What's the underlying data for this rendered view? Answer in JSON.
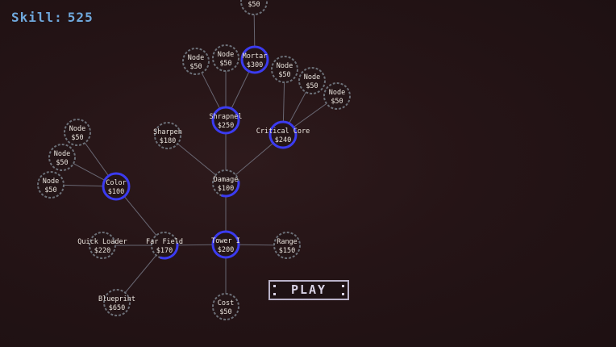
{
  "hud": {
    "skill_label": "Skill:",
    "skill_value": "525"
  },
  "play_label": "PLAY",
  "colors": {
    "accent": "#3b3bf0",
    "edge": "#7d8290",
    "ring_dim": "#6b6f77",
    "hud": "#6fa8dc"
  },
  "nodes": [
    {
      "id": "top",
      "name": "",
      "cost": "$50",
      "state": "dim"
    },
    {
      "id": "node-a",
      "name": "Node",
      "cost": "$50",
      "state": "dim"
    },
    {
      "id": "node-b",
      "name": "Node",
      "cost": "$50",
      "state": "dim"
    },
    {
      "id": "mortar",
      "name": "Mortar",
      "cost": "$300",
      "state": "full"
    },
    {
      "id": "node-c",
      "name": "Node",
      "cost": "$50",
      "state": "dim"
    },
    {
      "id": "node-d",
      "name": "Node",
      "cost": "$50",
      "state": "dim"
    },
    {
      "id": "node-e",
      "name": "Node",
      "cost": "$50",
      "state": "dim"
    },
    {
      "id": "shrapnel",
      "name": "Shrapnel",
      "cost": "$250",
      "state": "full"
    },
    {
      "id": "critcore",
      "name": "Critical Core",
      "cost": "$240",
      "state": "full"
    },
    {
      "id": "sharpen",
      "name": "Sharpen",
      "cost": "$180",
      "state": "dim"
    },
    {
      "id": "node-f",
      "name": "Node",
      "cost": "$50",
      "state": "dim"
    },
    {
      "id": "node-g",
      "name": "Node",
      "cost": "$50",
      "state": "dim"
    },
    {
      "id": "node-h",
      "name": "Node",
      "cost": "$50",
      "state": "dim"
    },
    {
      "id": "color",
      "name": "Color",
      "cost": "$100",
      "state": "full"
    },
    {
      "id": "damage",
      "name": "Damage",
      "cost": "$100",
      "state": "partial"
    },
    {
      "id": "quickload",
      "name": "Quick Loader",
      "cost": "$220",
      "state": "dim"
    },
    {
      "id": "farfield",
      "name": "Far Field",
      "cost": "$170",
      "state": "partial"
    },
    {
      "id": "tower",
      "name": "Tower I",
      "cost": "$200",
      "state": "full"
    },
    {
      "id": "range",
      "name": "Range",
      "cost": "$150",
      "state": "dim"
    },
    {
      "id": "blueprint",
      "name": "Blueprint",
      "cost": "$650",
      "state": "dim"
    },
    {
      "id": "cost",
      "name": "Cost",
      "cost": "$50",
      "state": "dim"
    }
  ],
  "edges": [
    [
      "tower",
      "damage"
    ],
    [
      "tower",
      "range"
    ],
    [
      "tower",
      "cost"
    ],
    [
      "tower",
      "farfield"
    ],
    [
      "farfield",
      "quickload"
    ],
    [
      "farfield",
      "blueprint"
    ],
    [
      "farfield",
      "color"
    ],
    [
      "color",
      "node-f"
    ],
    [
      "color",
      "node-g"
    ],
    [
      "color",
      "node-h"
    ],
    [
      "damage",
      "sharpen"
    ],
    [
      "damage",
      "shrapnel"
    ],
    [
      "damage",
      "critcore"
    ],
    [
      "shrapnel",
      "node-a"
    ],
    [
      "shrapnel",
      "node-b"
    ],
    [
      "shrapnel",
      "mortar"
    ],
    [
      "critcore",
      "node-c"
    ],
    [
      "critcore",
      "node-d"
    ],
    [
      "critcore",
      "node-e"
    ],
    [
      "mortar",
      "top"
    ]
  ]
}
